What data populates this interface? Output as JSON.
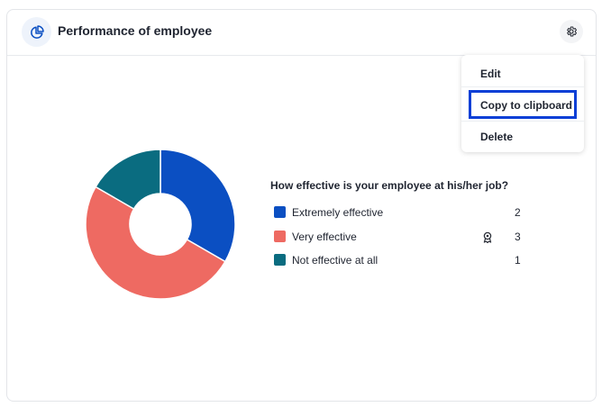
{
  "widget": {
    "title": "Performance of employee",
    "header_icon": "pie-chart-icon",
    "settings_icon": "gear-icon"
  },
  "menu": {
    "edit": "Edit",
    "copy": "Copy to clipboard",
    "delete": "Delete"
  },
  "chart_data": {
    "type": "pie",
    "title": "How effective is your employee at his/her job?",
    "donut": true,
    "categories": [
      "Extremely effective",
      "Very effective",
      "Not effective at all"
    ],
    "values": [
      2,
      3,
      1
    ],
    "colors": [
      "#0b4fc2",
      "#ee6a62",
      "#0a6c80"
    ]
  },
  "legend_badge_icon": "award-icon"
}
